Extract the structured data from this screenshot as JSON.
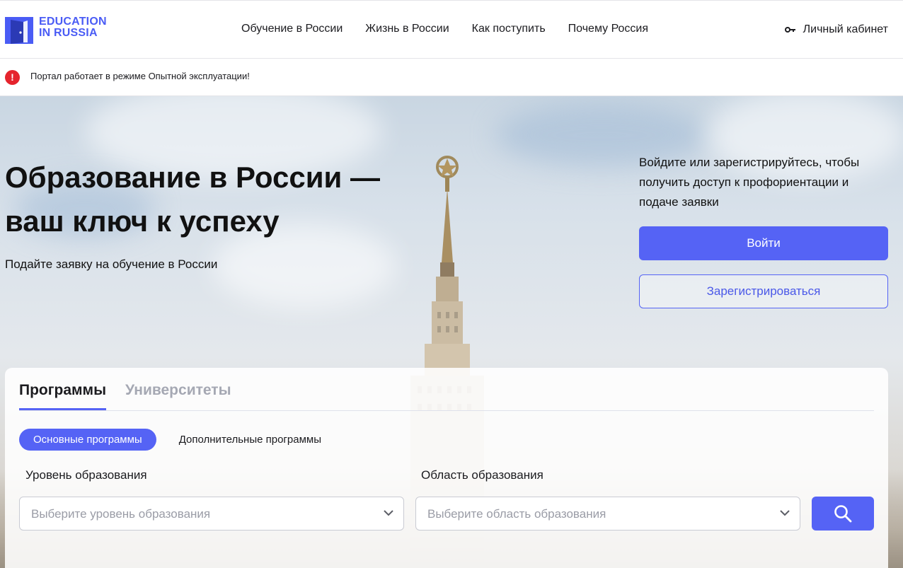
{
  "header": {
    "logo_line1": "EDUCATION",
    "logo_line2": "IN RUSSIA",
    "nav": [
      {
        "label": "Обучение в России"
      },
      {
        "label": "Жизнь в России"
      },
      {
        "label": "Как поступить"
      },
      {
        "label": "Почему Россия"
      }
    ],
    "cabinet_label": "Личный кабинет"
  },
  "notice": {
    "icon": "!",
    "text": "Портал работает в режиме Опытной эксплуатации!"
  },
  "hero": {
    "title_line1": "Образование в России —",
    "title_line2": "ваш ключ к успеху",
    "subtitle": "Подайте заявку на обучение в России"
  },
  "login": {
    "text": "Войдите или зарегистрируйтесь, чтобы получить доступ к профориентации и подаче заявки",
    "login_button": "Войти",
    "register_button": "Зарегистрироваться"
  },
  "search": {
    "tabs": [
      {
        "label": "Программы",
        "active": true
      },
      {
        "label": "Университеты",
        "active": false
      }
    ],
    "pills": [
      {
        "label": "Основные программы",
        "active": true
      },
      {
        "label": "Дополнительные программы",
        "active": false
      }
    ],
    "level_label": "Уровень образования",
    "level_placeholder": "Выберите уровень образования",
    "area_label": "Область образования",
    "area_placeholder": "Выберите область образования"
  },
  "colors": {
    "accent": "#5563f5",
    "logo": "#4a5cf5",
    "alert": "#e5242d"
  }
}
